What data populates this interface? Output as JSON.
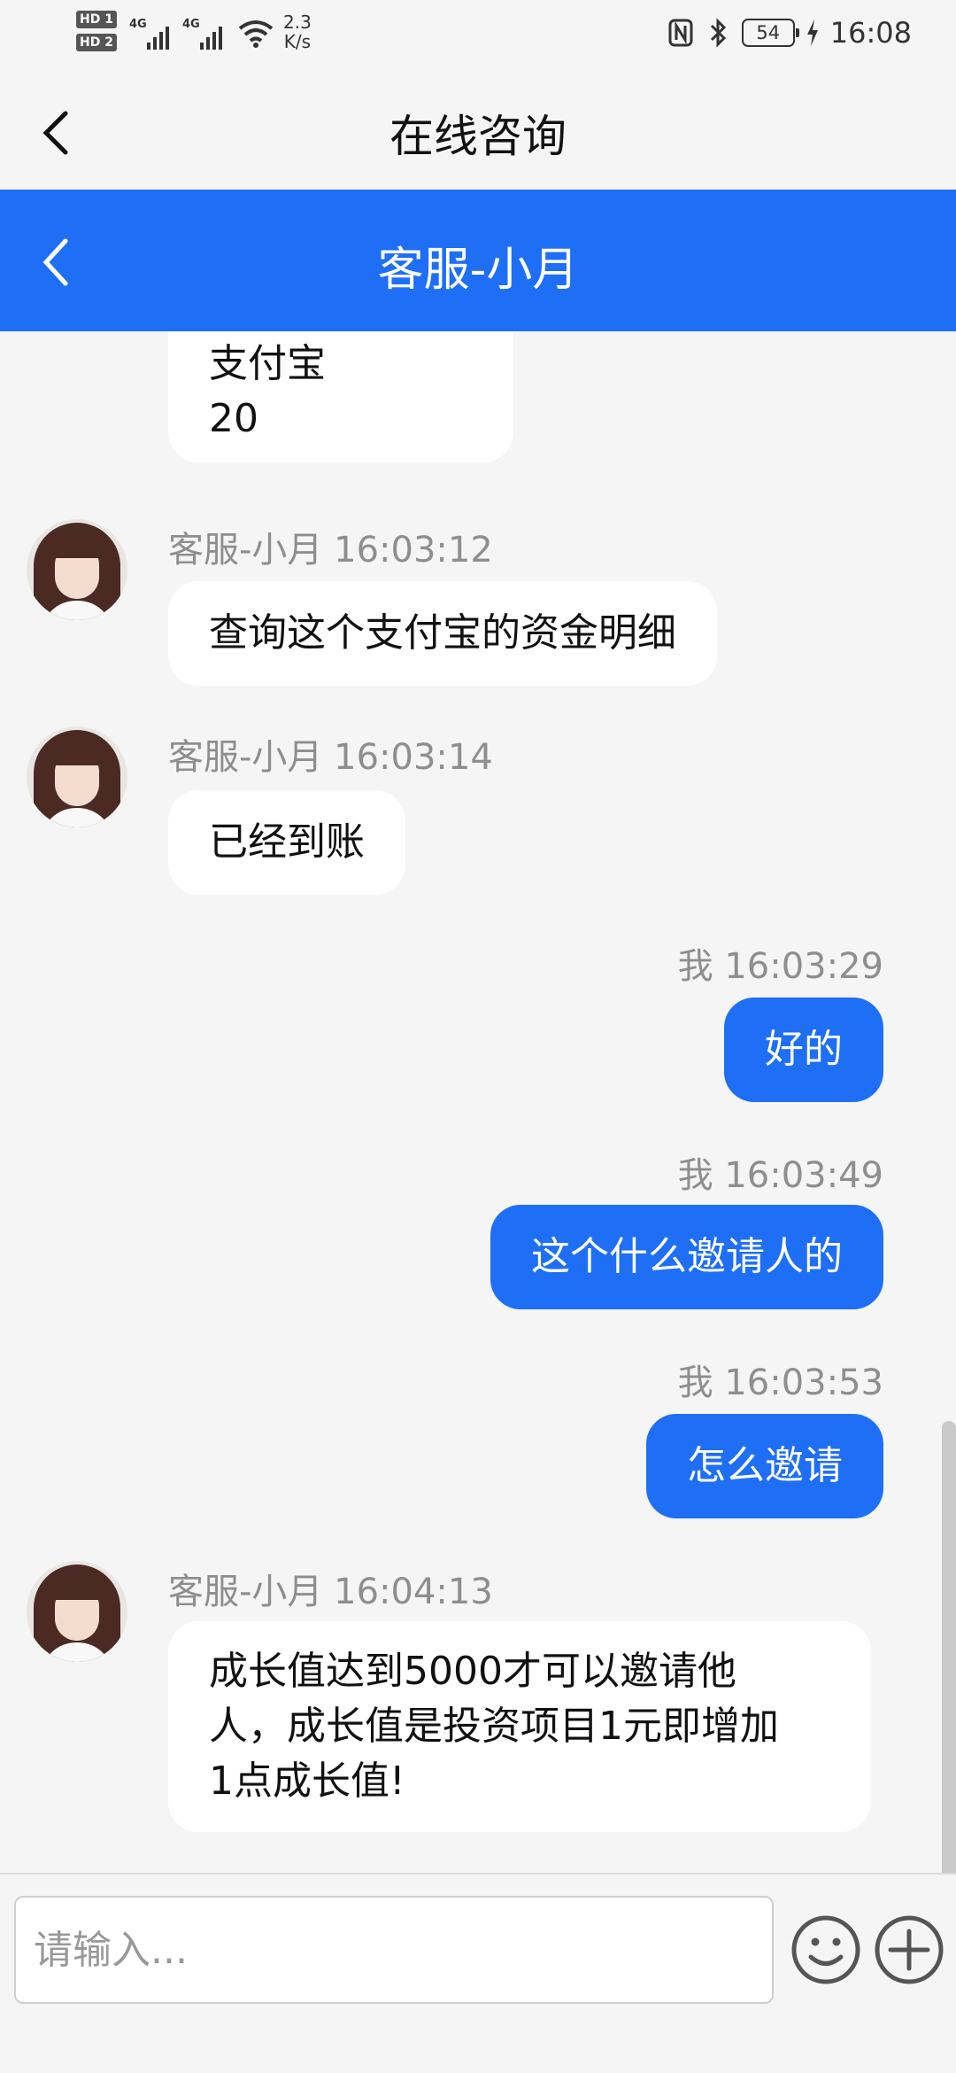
{
  "status_bar": {
    "sim1": "HD 1",
    "sim2": "HD 2",
    "network1": "4G",
    "network2": "4G",
    "speed_value": "2.3",
    "speed_unit": "K/s",
    "battery": "54",
    "time": "16:08"
  },
  "header": {
    "title": "在线咨询"
  },
  "chat_header": {
    "title": "客服-小月"
  },
  "messages": [
    {
      "side": "in",
      "sender": "",
      "time": "",
      "lines": [
        "支付宝",
        "20"
      ]
    },
    {
      "side": "in",
      "sender": "客服-小月",
      "time": "16:03:12",
      "lines": [
        "查询这个支付宝的资金明细"
      ]
    },
    {
      "side": "in",
      "sender": "客服-小月",
      "time": "16:03:14",
      "lines": [
        "已经到账"
      ]
    },
    {
      "side": "out",
      "sender": "我",
      "time": "16:03:29",
      "lines": [
        "好的"
      ]
    },
    {
      "side": "out",
      "sender": "我",
      "time": "16:03:49",
      "lines": [
        "这个什么邀请人的"
      ]
    },
    {
      "side": "out",
      "sender": "我",
      "time": "16:03:53",
      "lines": [
        "怎么邀请"
      ]
    },
    {
      "side": "in",
      "sender": "客服-小月",
      "time": "16:04:13",
      "lines": [
        "成长值达到5000才可以邀请他",
        "人，成长值是投资项目1元即增加",
        "1点成长值!"
      ]
    }
  ],
  "input": {
    "placeholder": "请输入..."
  },
  "icons": {
    "back": "chevron-left-icon",
    "emoji": "smiley-icon",
    "plus": "plus-icon"
  },
  "colors": {
    "accent": "#1e6ff6",
    "background": "#f5f5f5",
    "bubble_in": "#ffffff",
    "meta_text": "#8e8e8e"
  }
}
